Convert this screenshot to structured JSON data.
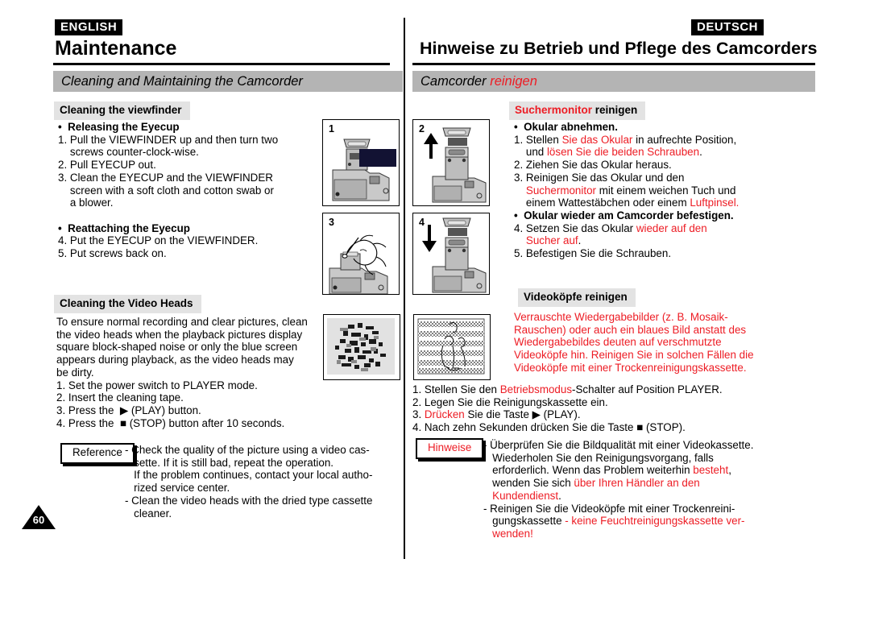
{
  "languages": {
    "english_badge": "ENGLISH",
    "german_badge": "DEUTSCH"
  },
  "titles": {
    "english": "Maintenance",
    "german": "Hinweise zu Betrieb und Pflege des Camcorders"
  },
  "section_bars": {
    "english": "Cleaning and Maintaining the Camcorder",
    "german_plain": "Camcorder ",
    "german_red": "reinigen"
  },
  "english_column": {
    "subheading_1": "Cleaning the viewfinder",
    "body_1_lines": [
      "•  Releasing the Eyecup",
      "1. Pull the VIEWFINDER up and then turn two",
      "    screws counter-clock-wise.",
      "2. Pull EYECUP out.",
      "3. Clean the EYECUP and the VIEWFINDER",
      "    screen with a soft cloth and cotton swab or",
      "    a blower.",
      "",
      "•  Reattaching the Eyecup",
      "4. Put the EYECUP on the VIEWFINDER.",
      "5. Put screws back on."
    ],
    "subheading_2": "Cleaning the Video Heads",
    "body_2_lines": [
      "To ensure normal recording and clear pictures, clean",
      "the video heads when the playback pictures display",
      "square block-shaped noise or only the blue screen",
      "appears during playback, as the video heads may",
      "be dirty.",
      "1. Set the power switch to PLAYER mode.",
      "2. Insert the cleaning tape.",
      "3. Press the  ▶ (PLAY) button.",
      "4. Press the  ■ (STOP) button after 10 seconds."
    ],
    "reference_label": "Reference",
    "reference_lines": [
      "- Check the quality of the picture using a video cas-",
      "   sette. If it is still bad, repeat the operation.",
      "   If the problem continues, contact your local autho-",
      "   rized service center.",
      "- Clean the video heads with the dried type cassette",
      "   cleaner."
    ]
  },
  "german_column": {
    "subheading_1_red": "Suchermonitor",
    "subheading_1_black": " reinigen",
    "body_1_lines": [
      {
        "text": "•  Okular abnehmen.",
        "bold": true,
        "color": "black"
      },
      {
        "segments": [
          {
            "t": "1. Stellen ",
            "c": "black"
          },
          {
            "t": "Sie das Okular",
            "c": "red"
          },
          {
            "t": " in aufrechte Position,",
            "c": "black"
          }
        ]
      },
      {
        "segments": [
          {
            "t": "    und ",
            "c": "black"
          },
          {
            "t": "lösen Sie die beiden Schrauben",
            "c": "red"
          },
          {
            "t": ".",
            "c": "black"
          }
        ]
      },
      {
        "text": "2. Ziehen Sie das Okular heraus.",
        "color": "black"
      },
      {
        "text": "3. Reinigen Sie das Okular und den",
        "color": "black"
      },
      {
        "segments": [
          {
            "t": "    ",
            "c": "black"
          },
          {
            "t": "Suchermonitor",
            "c": "red"
          },
          {
            "t": " mit einem weichen Tuch und",
            "c": "black"
          }
        ]
      },
      {
        "segments": [
          {
            "t": "    einem Wattestäbchen oder einem ",
            "c": "black"
          },
          {
            "t": "Luftpinsel.",
            "c": "red"
          }
        ]
      },
      {
        "text": "•  Okular wieder am Camcorder befestigen.",
        "bold": true,
        "color": "black"
      },
      {
        "segments": [
          {
            "t": "4. Setzen Sie das Okular ",
            "c": "black"
          },
          {
            "t": "wieder auf den",
            "c": "red"
          }
        ]
      },
      {
        "segments": [
          {
            "t": "    ",
            "c": "black"
          },
          {
            "t": "Sucher auf",
            "c": "red"
          },
          {
            "t": ".",
            "c": "black"
          }
        ]
      },
      {
        "text": "5. Befestigen Sie die Schrauben.",
        "color": "black"
      }
    ],
    "subheading_2": "Videoköpfe reinigen",
    "body_2_lines_red": [
      "Verrauschte Wiedergabebilder (z. B. Mosaik-",
      "Rauschen) oder auch ein blaues Bild anstatt des",
      "Wiedergabebildes deuten auf verschmutzte",
      "Videoköpfe hin. Reinigen Sie in solchen Fällen die",
      "Videoköpfe mit einer Trockenreinigungskassette."
    ],
    "body_3_lines": [
      [
        {
          "t": "1. Stellen Sie den ",
          "c": "black"
        },
        {
          "t": "Betriebsmodus",
          "c": "red"
        },
        {
          "t": "-Schalter auf Position PLAYER.",
          "c": "black"
        }
      ],
      [
        {
          "t": "2. Legen Sie die Reinigungskassette ein.",
          "c": "black"
        }
      ],
      [
        {
          "t": "3. ",
          "c": "black"
        },
        {
          "t": "Drücken",
          "c": "red"
        },
        {
          "t": " Sie die Taste ▶ (PLAY).",
          "c": "black"
        }
      ],
      [
        {
          "t": "4. Nach zehn Sekunden drücken Sie die Taste ■ (STOP).",
          "c": "black"
        }
      ]
    ],
    "reference_label": "Hinweise",
    "reference_lines": [
      [
        {
          "t": "- Überprüfen Sie die Bildqualität mit einer Videokassette.",
          "c": "black"
        }
      ],
      [
        {
          "t": "   Wiederholen Sie den Reinigungsvorgang, falls",
          "c": "black"
        }
      ],
      [
        {
          "t": "   erforderlich. Wenn das Problem weiterhin ",
          "c": "black"
        },
        {
          "t": "besteht",
          "c": "red"
        },
        {
          "t": ",",
          "c": "black"
        }
      ],
      [
        {
          "t": "   wenden Sie sich ",
          "c": "black"
        },
        {
          "t": "über Ihren Händler an den",
          "c": "red"
        }
      ],
      [
        {
          "t": "   ",
          "c": "black"
        },
        {
          "t": "Kundendienst",
          "c": "red"
        },
        {
          "t": ".",
          "c": "black"
        }
      ],
      [
        {
          "t": "- Reinigen Sie die Videoköpfe mit einer Trockenreini-",
          "c": "black"
        }
      ],
      [
        {
          "t": "   gungskassette ",
          "c": "black"
        },
        {
          "t": "- keine Feuchtreinigungskassette ver-",
          "c": "red"
        }
      ],
      [
        {
          "t": "   ",
          "c": "black"
        },
        {
          "t": "wenden!",
          "c": "red"
        }
      ]
    ]
  },
  "illustrations": {
    "panel_1_number": "1",
    "panel_2_number": "2",
    "panel_3_number": "3",
    "panel_4_number": "4"
  },
  "page_number": "60",
  "colors": {
    "red_accent": "#ed1c24",
    "section_bar_gray": "#b4b4b4",
    "subhead_gray": "#e3e3e3"
  }
}
